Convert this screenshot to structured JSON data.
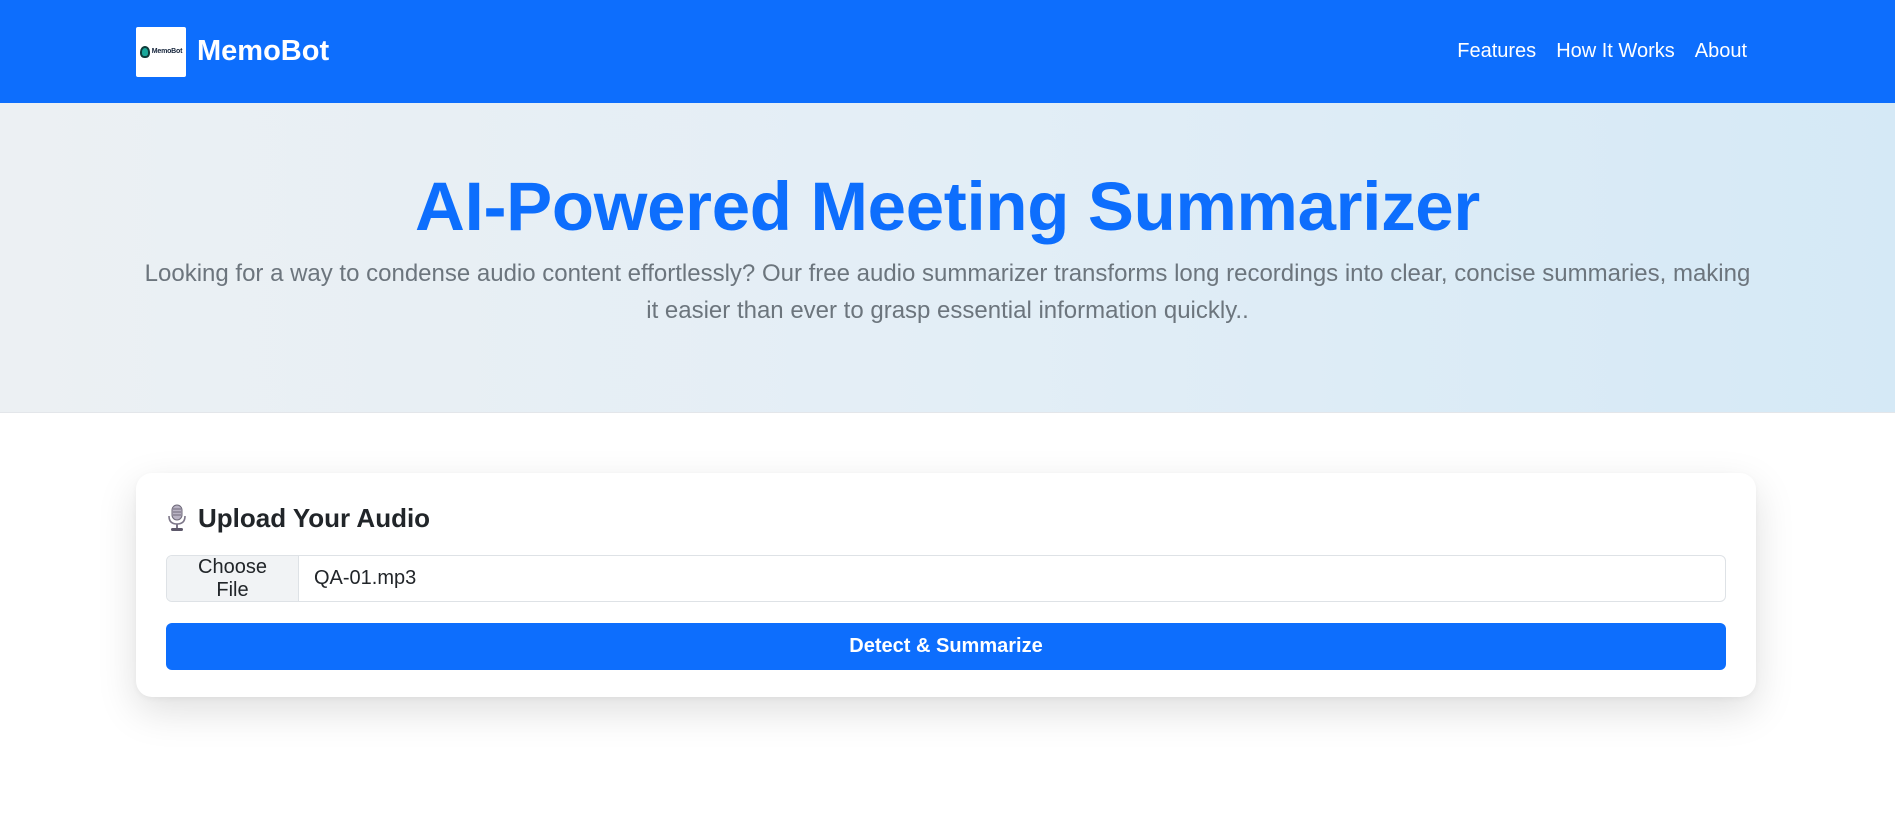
{
  "colors": {
    "primary": "#0d6efd",
    "muted_text": "#6c757d"
  },
  "navbar": {
    "brand_name": "MemoBot",
    "logo_text": "MemoBot",
    "links": [
      "Features",
      "How It Works",
      "About"
    ]
  },
  "hero": {
    "title": "AI-Powered Meeting Summarizer",
    "subtitle": "Looking for a way to condense audio content effortlessly? Our free audio summarizer transforms long recordings into clear, concise summaries, making it easier than ever to grasp essential information quickly.."
  },
  "upload": {
    "icon": "microphone-icon",
    "title": "Upload Your Audio",
    "choose_file_label": "Choose File",
    "file_name": "QA-01.mp3",
    "submit_label": "Detect & Summarize"
  }
}
